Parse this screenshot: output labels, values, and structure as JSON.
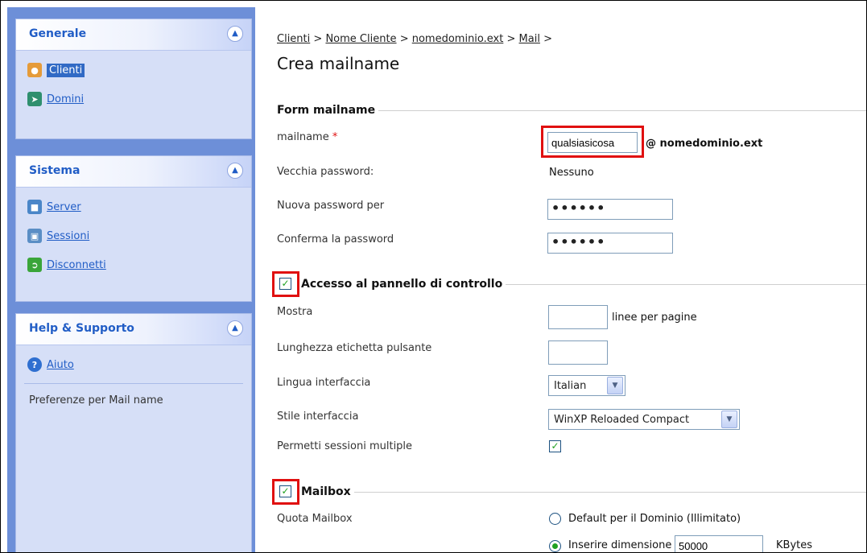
{
  "sidebar": {
    "generale": {
      "title": "Generale",
      "items": [
        {
          "label": "Clienti",
          "icon": "user-icon"
        },
        {
          "label": "Domini",
          "icon": "domains-icon"
        }
      ]
    },
    "sistema": {
      "title": "Sistema",
      "items": [
        {
          "label": "Server",
          "icon": "server-icon"
        },
        {
          "label": "Sessioni",
          "icon": "sessions-icon"
        },
        {
          "label": "Disconnetti",
          "icon": "logout-icon"
        }
      ]
    },
    "help": {
      "title": "Help & Supporto",
      "items": [
        {
          "label": "Aiuto",
          "icon": "help-icon"
        }
      ],
      "context_text": "Preferenze per Mail name"
    }
  },
  "breadcrumb": {
    "items": [
      "Clienti",
      "Nome Cliente",
      "nomedominio.ext",
      "Mail"
    ],
    "separator": ">"
  },
  "page_title": "Crea mailname",
  "form": {
    "section_title": "Form mailname",
    "mailname_label": "mailname",
    "required_mark": "*",
    "mailname_value": "qualsiasicosa",
    "domain_suffix": "@ nomedominio.ext",
    "old_password_label": "Vecchia password:",
    "old_password_value": "Nessuno",
    "new_password_label": "Nuova password per",
    "new_password_value": "••••••",
    "confirm_password_label": "Conferma la password",
    "confirm_password_value": "••••••"
  },
  "control_panel": {
    "section_title": "Accesso al pannello di controllo",
    "checked": true,
    "show_label": "Mostra",
    "show_value": "",
    "show_suffix": "linee per pagine",
    "button_label_length_label": "Lunghezza etichetta pulsante",
    "button_label_length_value": "",
    "language_label": "Lingua interfaccia",
    "language_value": "Italian",
    "style_label": "Stile interfaccia",
    "style_value": "WinXP Reloaded Compact",
    "multi_sessions_label": "Permetti sessioni multiple",
    "multi_sessions_checked": true
  },
  "mailbox": {
    "section_title": "Mailbox",
    "checked": true,
    "quota_label": "Quota Mailbox",
    "option_default": "Default per il Dominio (Illimitato)",
    "option_custom": "Inserire dimensione",
    "custom_value": "50000",
    "unit": "KBytes",
    "selected": "custom"
  },
  "colors": {
    "sidebar_bg": "#6d8fd8",
    "panel_bg": "#d6dff7",
    "link": "#215dc6",
    "highlight": "#e01010",
    "check": "#21a121"
  }
}
